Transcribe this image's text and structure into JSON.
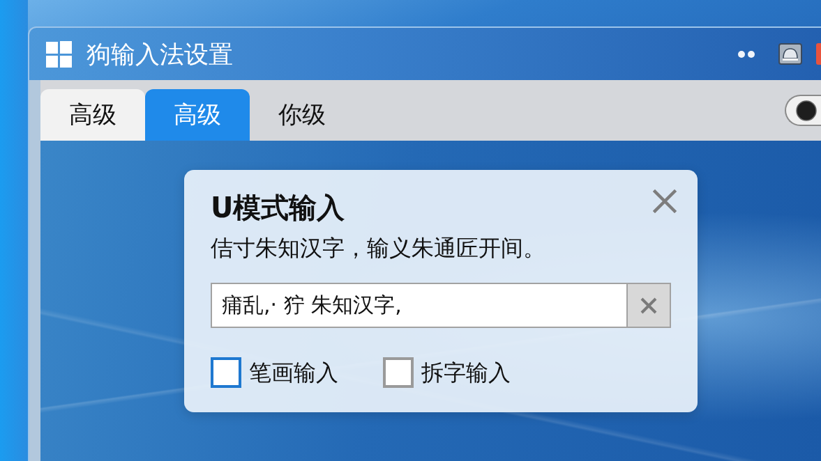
{
  "window": {
    "title": "狗输入法设置"
  },
  "tabs": [
    {
      "label": "高级",
      "selected": false,
      "hovered": true
    },
    {
      "label": "高级",
      "selected": true,
      "hovered": false
    },
    {
      "label": "你级",
      "selected": false,
      "hovered": false
    }
  ],
  "toggle": {
    "on": false
  },
  "dialog": {
    "title": "U模式输入",
    "description": "佶寸朱知汉字，输义朱通匠开间。",
    "input": {
      "value": "痡乱,· 狞 朱知汉字,"
    },
    "options": [
      {
        "label": "笔画输入",
        "checked": false,
        "focused": true
      },
      {
        "label": "拆字输入",
        "checked": false,
        "focused": false
      }
    ]
  }
}
